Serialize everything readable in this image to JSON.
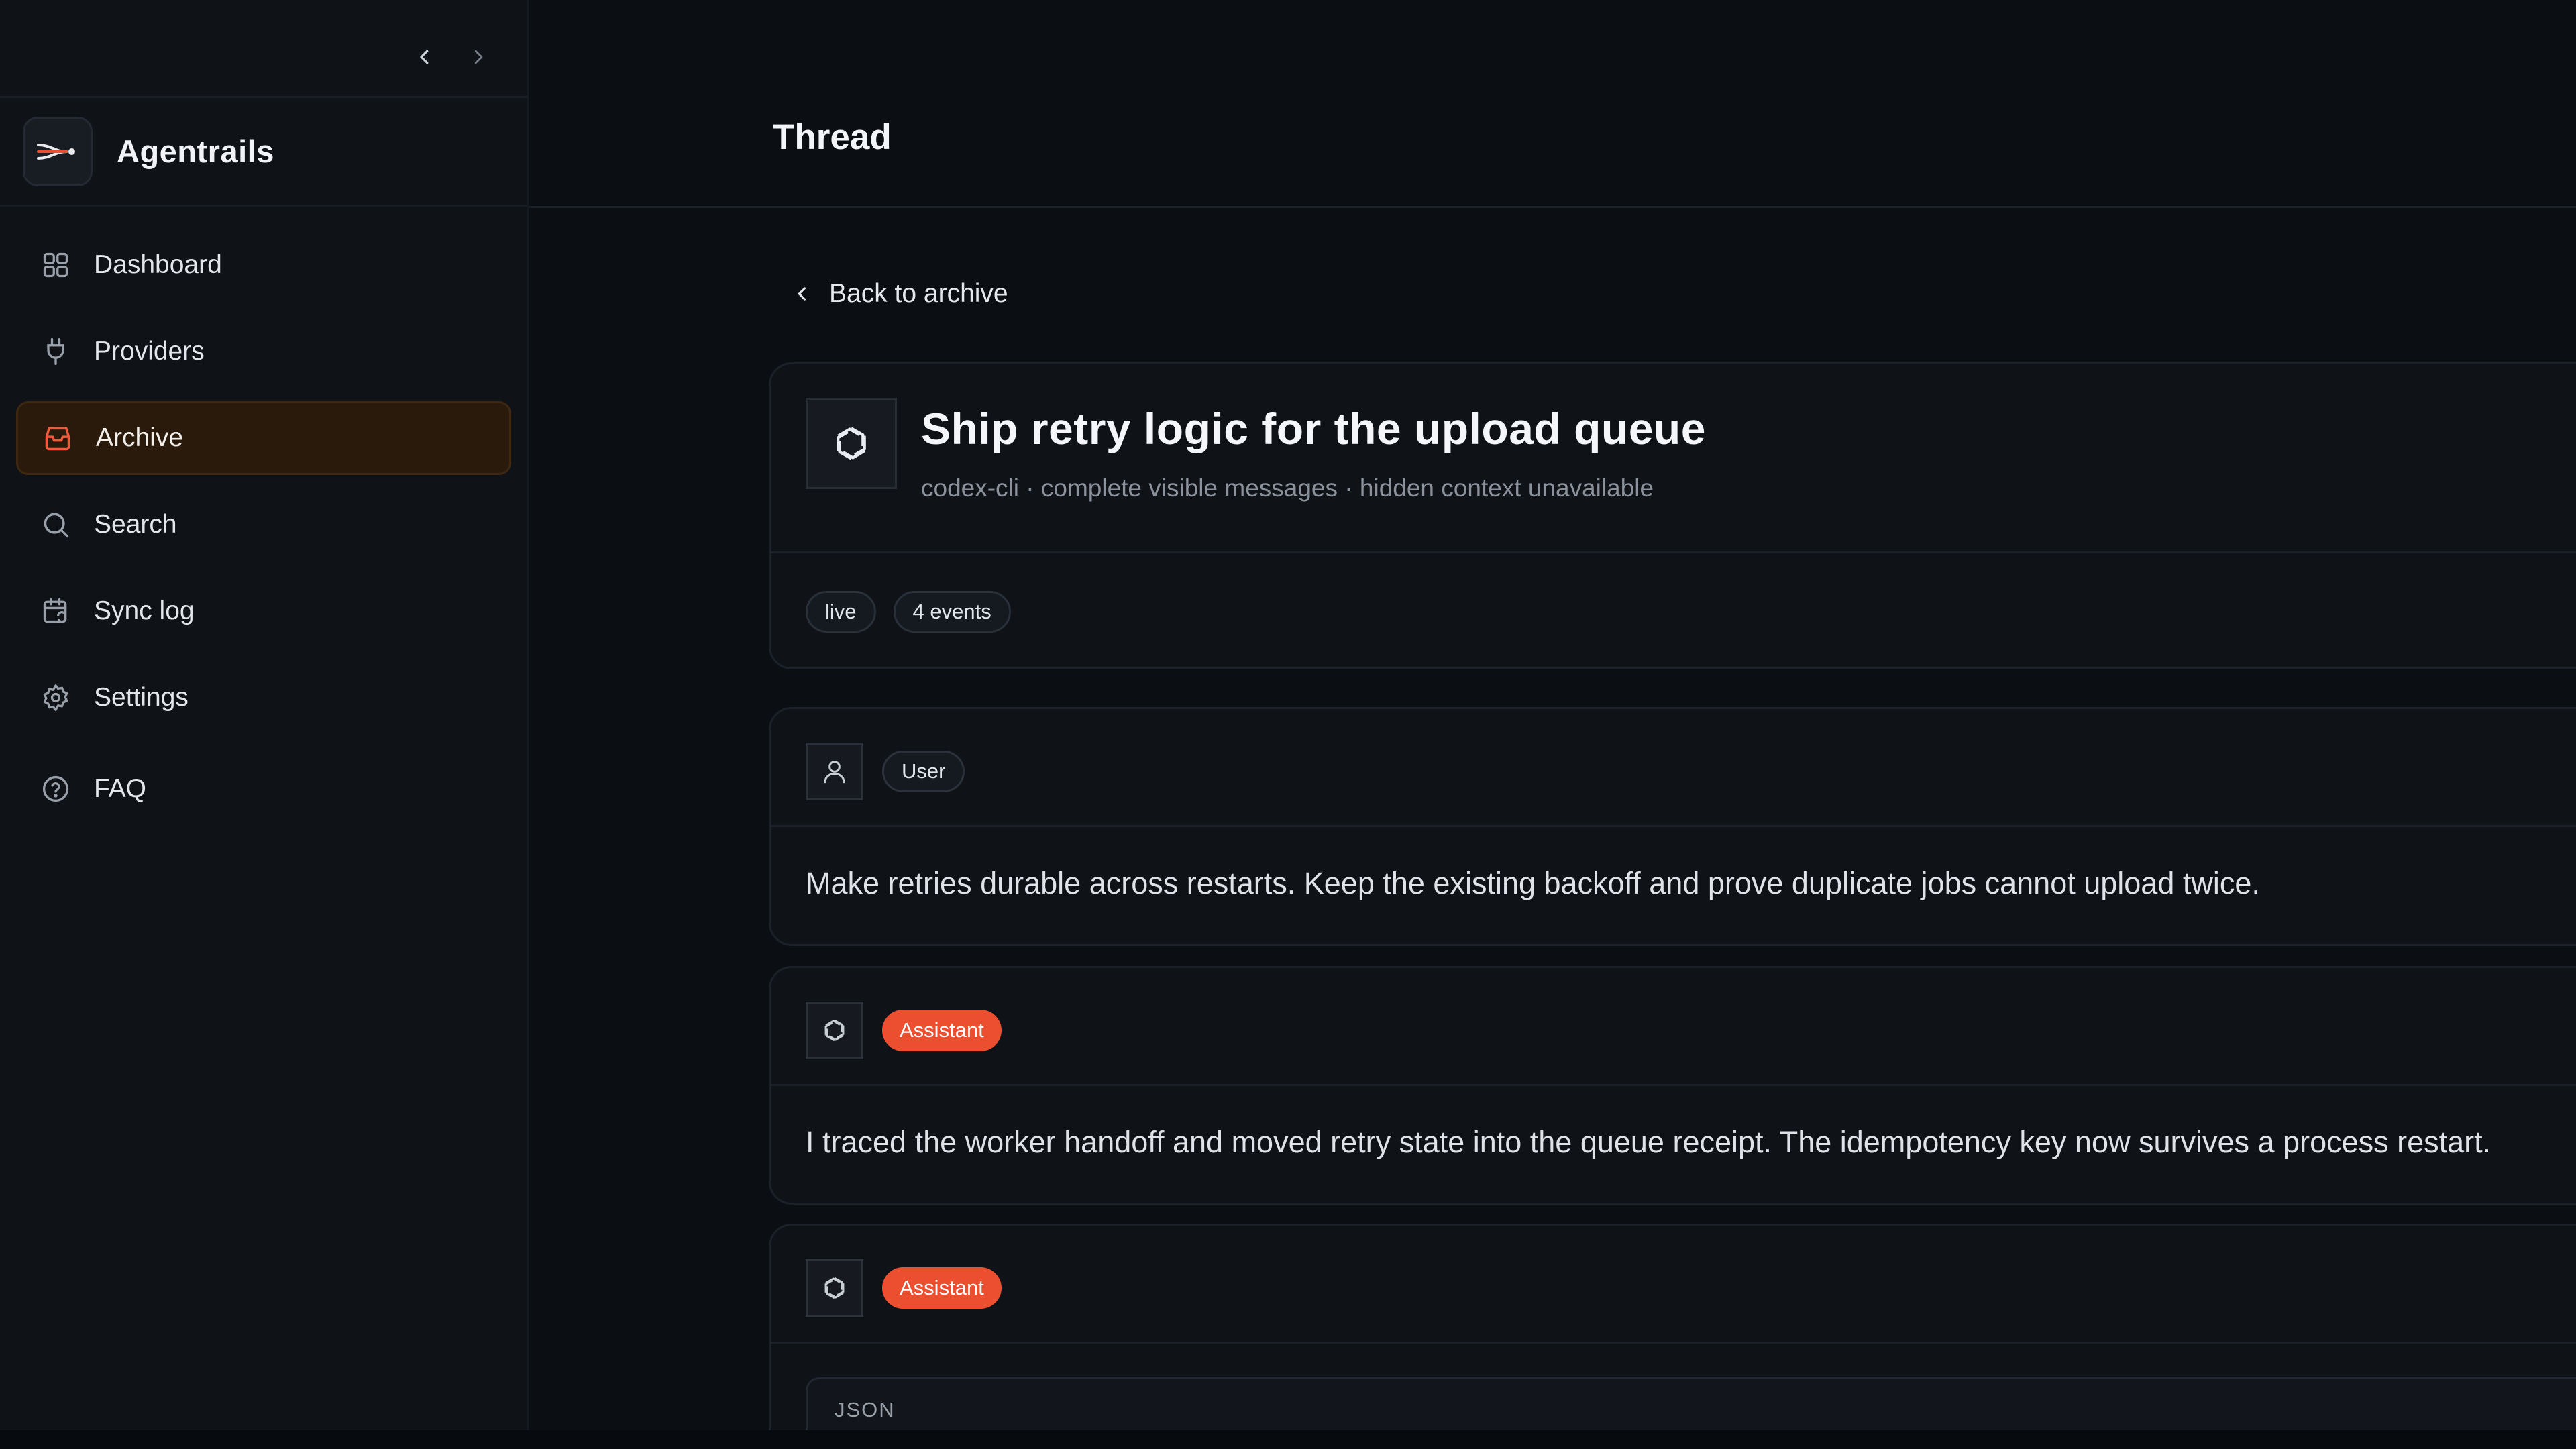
{
  "app": {
    "name": "Agentrails"
  },
  "sidebar": {
    "items": [
      {
        "label": "Dashboard",
        "icon": "dashboard-grid-icon"
      },
      {
        "label": "Providers",
        "icon": "plug-icon"
      },
      {
        "label": "Archive",
        "icon": "archive-box-icon",
        "active": true
      },
      {
        "label": "Search",
        "icon": "search-icon"
      },
      {
        "label": "Sync log",
        "icon": "calendar-sync-icon"
      },
      {
        "label": "Settings",
        "icon": "gear-icon"
      },
      {
        "label": "FAQ",
        "icon": "help-circle-icon"
      }
    ]
  },
  "header": {
    "title": "Thread"
  },
  "back": {
    "label": "Back to archive"
  },
  "thread": {
    "title": "Ship retry logic for the upload queue",
    "subtitle": "codex-cli · complete visible messages · hidden context unavailable",
    "tags": [
      "live",
      "4 events"
    ]
  },
  "messages": [
    {
      "role": "User",
      "text": "Make retries durable across restarts. Keep the existing backoff and prove duplicate jobs cannot upload twice."
    },
    {
      "role": "Assistant",
      "text": "I traced the worker handoff and moved retry state into the queue receipt. The idempotency key now survives a process restart."
    },
    {
      "role": "Assistant",
      "block_label": "JSON"
    }
  ],
  "colors": {
    "accent": "#ec4f2f",
    "active_bg": "#2a1a0c",
    "background": "#0b0e13"
  }
}
